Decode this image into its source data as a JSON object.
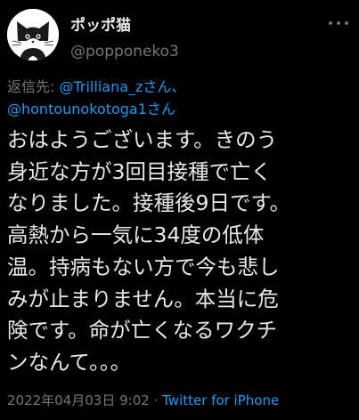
{
  "author": {
    "display_name": "ポッポ猫",
    "handle": "@popponeko3",
    "avatar_icon": "cat-avatar-icon"
  },
  "reply": {
    "prefix": "返信先: ",
    "mention1": "@Trilliana_z",
    "mention1_suffix": "さん、",
    "mention2": "@hontounokotoga1",
    "mention2_suffix": "さん"
  },
  "tweet": {
    "lines": [
      "おはようございます。きのう",
      "身近な方が3回目接種で亡く",
      "なりました。接種後9日です。",
      "高熱から一気に34度の低体",
      "温。持病もない方で今も悲し",
      "みが止まりません。本当に危",
      "険です。命が亡くなるワクチ",
      "ンなんて。。。"
    ]
  },
  "meta": {
    "timestamp": "2022年04月03日 9:02",
    "separator": " · ",
    "source": "Twitter for iPhone"
  },
  "colors": {
    "background": "#000000",
    "text": "#e7e9ea",
    "secondary": "#71767b",
    "link": "#1d9bf0"
  },
  "menu": {
    "icon": "more-options-icon"
  }
}
